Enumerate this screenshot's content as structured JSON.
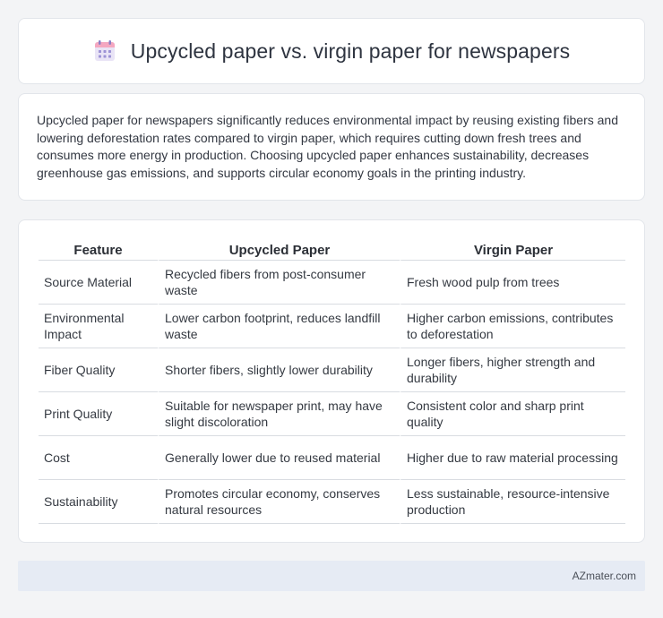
{
  "header": {
    "title": "Upcycled paper vs. virgin paper for newspapers",
    "icon": "calendar-icon"
  },
  "intro": {
    "text": "Upcycled paper for newspapers significantly reduces environmental impact by reusing existing fibers and lowering deforestation rates compared to virgin paper, which requires cutting down fresh trees and consumes more energy in production. Choosing upcycled paper enhances sustainability, decreases greenhouse gas emissions, and supports circular economy goals in the printing industry."
  },
  "table": {
    "headers": [
      "Feature",
      "Upcycled Paper",
      "Virgin Paper"
    ],
    "rows": [
      [
        "Source Material",
        "Recycled fibers from post-consumer waste",
        "Fresh wood pulp from trees"
      ],
      [
        "Environmental Impact",
        "Lower carbon footprint, reduces landfill waste",
        "Higher carbon emissions, contributes to deforestation"
      ],
      [
        "Fiber Quality",
        "Shorter fibers, slightly lower durability",
        "Longer fibers, higher strength and durability"
      ],
      [
        "Print Quality",
        "Suitable for newspaper print, may have slight discoloration",
        "Consistent color and sharp print quality"
      ],
      [
        "Cost",
        "Generally lower due to reused material",
        "Higher due to raw material processing"
      ],
      [
        "Sustainability",
        "Promotes circular economy, conserves natural resources",
        "Less sustainable, resource-intensive production"
      ]
    ]
  },
  "footer": {
    "brand": "AZmater.com"
  }
}
